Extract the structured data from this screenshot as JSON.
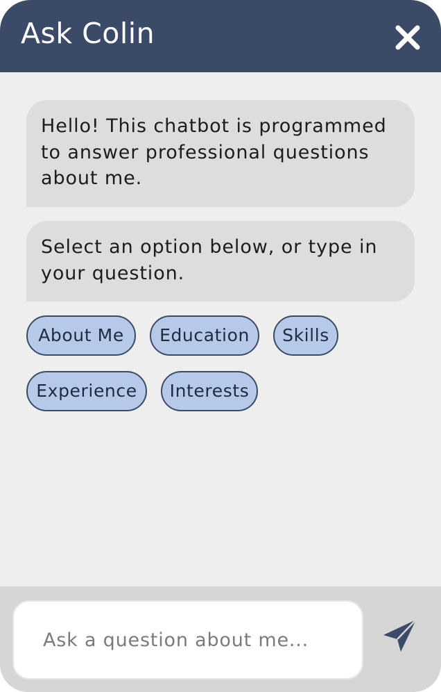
{
  "header": {
    "title": "Ask Colin",
    "close_icon": "close-icon",
    "background_color": "#3b4a67"
  },
  "messages": [
    {
      "sender": "bot",
      "text": "Hello! This chatbot is programmed to answer professional questions about me."
    },
    {
      "sender": "bot",
      "text": "Select an option below, or type in your question."
    }
  ],
  "options": [
    {
      "label": "About Me"
    },
    {
      "label": "Education"
    },
    {
      "label": "Skills"
    },
    {
      "label": "Experience"
    },
    {
      "label": "Interests"
    }
  ],
  "input": {
    "placeholder": "Ask a question about me...",
    "value": "",
    "send_icon": "send-icon"
  },
  "colors": {
    "chat_background": "#eeeeee",
    "bubble": "#dddddd",
    "chip_fill": "#b7c9e9",
    "chip_border": "#3b4a67",
    "input_bar": "#d6d6d6"
  }
}
